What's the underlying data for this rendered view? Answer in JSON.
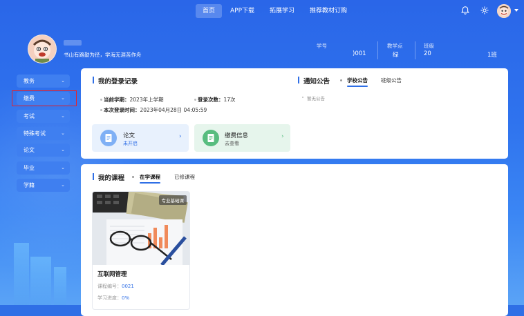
{
  "nav": {
    "items": [
      {
        "label": "首页",
        "active": true
      },
      {
        "label": "APP下载",
        "active": false
      },
      {
        "label": "拓展学习",
        "active": false
      },
      {
        "label": "推荐教材订购",
        "active": false
      }
    ],
    "icons": [
      "bell-icon",
      "settings-gear-icon",
      "user-avatar-icon",
      "caret-down-icon"
    ]
  },
  "profile": {
    "motto": "书山有路勤为径，学海无涯苦作舟",
    "student_id_label": "学号",
    "student_id_value": ")001",
    "campus_label": "教学点",
    "campus_value": "绿",
    "class_label": "班级",
    "class_value_prefix": "20",
    "class_value_suffix": "1班"
  },
  "sidebar": {
    "items": [
      {
        "label": "教务"
      },
      {
        "label": "缴费"
      },
      {
        "label": "考试"
      },
      {
        "label": "特殊考试"
      },
      {
        "label": "论文"
      },
      {
        "label": "毕业"
      },
      {
        "label": "学籍"
      }
    ],
    "highlighted_index": 1
  },
  "login_record": {
    "title": "我的登录记录",
    "term_label": "当前学期：",
    "term_value": "2023年上学期",
    "count_label": "登录次数：",
    "count_value": "17次",
    "last_label": "本次登录时间：",
    "last_value": "2023年04月28日 04:05:59",
    "tiles": [
      {
        "title": "论文",
        "subtitle": "未开启",
        "icon": "document-icon",
        "color": "#2f6fe6"
      },
      {
        "title": "缴费信息",
        "subtitle": "去查看",
        "icon": "payment-doc-icon",
        "color": "#2f9e5a"
      }
    ]
  },
  "notice": {
    "title": "通知公告",
    "tabs": [
      {
        "label": "学校公告",
        "active": true
      },
      {
        "label": "班级公告",
        "active": false
      }
    ],
    "empty_text": "暂无公告"
  },
  "courses": {
    "title": "我的课程",
    "tabs": [
      {
        "label": "在学课程",
        "active": true
      },
      {
        "label": "已修课程",
        "active": false
      }
    ],
    "items": [
      {
        "badge": "专业基础课",
        "name": "互联网管理",
        "code_label": "课程编号：",
        "code_value": "0021",
        "progress_label": "学习进度：",
        "progress_value": "0%"
      }
    ]
  },
  "colors": {
    "accent": "#2f6fe6",
    "highlight": "#e5242b"
  }
}
